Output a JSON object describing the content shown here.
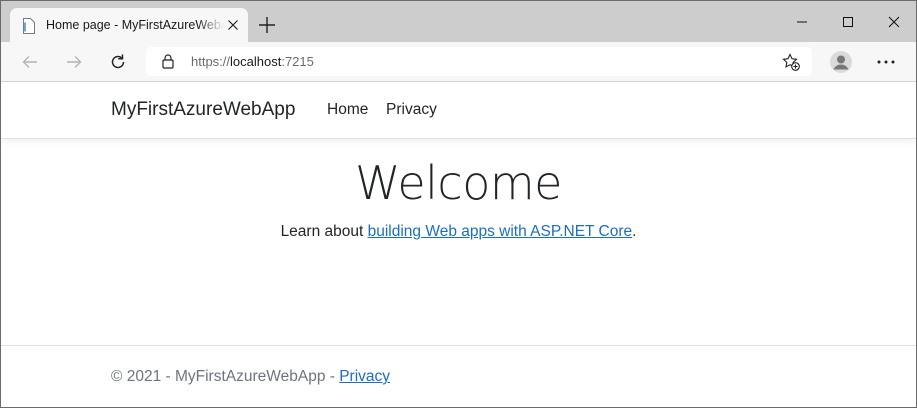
{
  "browser": {
    "tab": {
      "title": "Home page - MyFirstAzureWebApp",
      "icon": "page-icon",
      "close_icon": "close-icon"
    },
    "new_tab_icon": "plus-icon",
    "window_controls": [
      "minimize-icon",
      "maximize-icon",
      "close-icon"
    ],
    "address_bar": {
      "scheme": "https://",
      "host": "localhost",
      "port": ":7215",
      "lock_icon": "lock-icon",
      "favorites_icon": "star-add-icon"
    },
    "toolbar_icons": [
      "back-arrow-icon",
      "forward-arrow-icon",
      "refresh-icon",
      "profile-icon",
      "more-icon"
    ]
  },
  "site": {
    "navbar": {
      "brand": "MyFirstAzureWebApp",
      "links": [
        "Home",
        "Privacy"
      ]
    },
    "main": {
      "heading": "Welcome",
      "lead_prefix": "Learn about ",
      "lead_link": "building Web apps with ASP.NET Core",
      "lead_suffix": "."
    },
    "footer": {
      "text": "© 2021 - MyFirstAzureWebApp - ",
      "link": "Privacy"
    }
  },
  "colors": {
    "link": "#1b6ec2",
    "text": "#212529",
    "muted": "#6c757d",
    "tabstrip": "#cdcdcd"
  }
}
